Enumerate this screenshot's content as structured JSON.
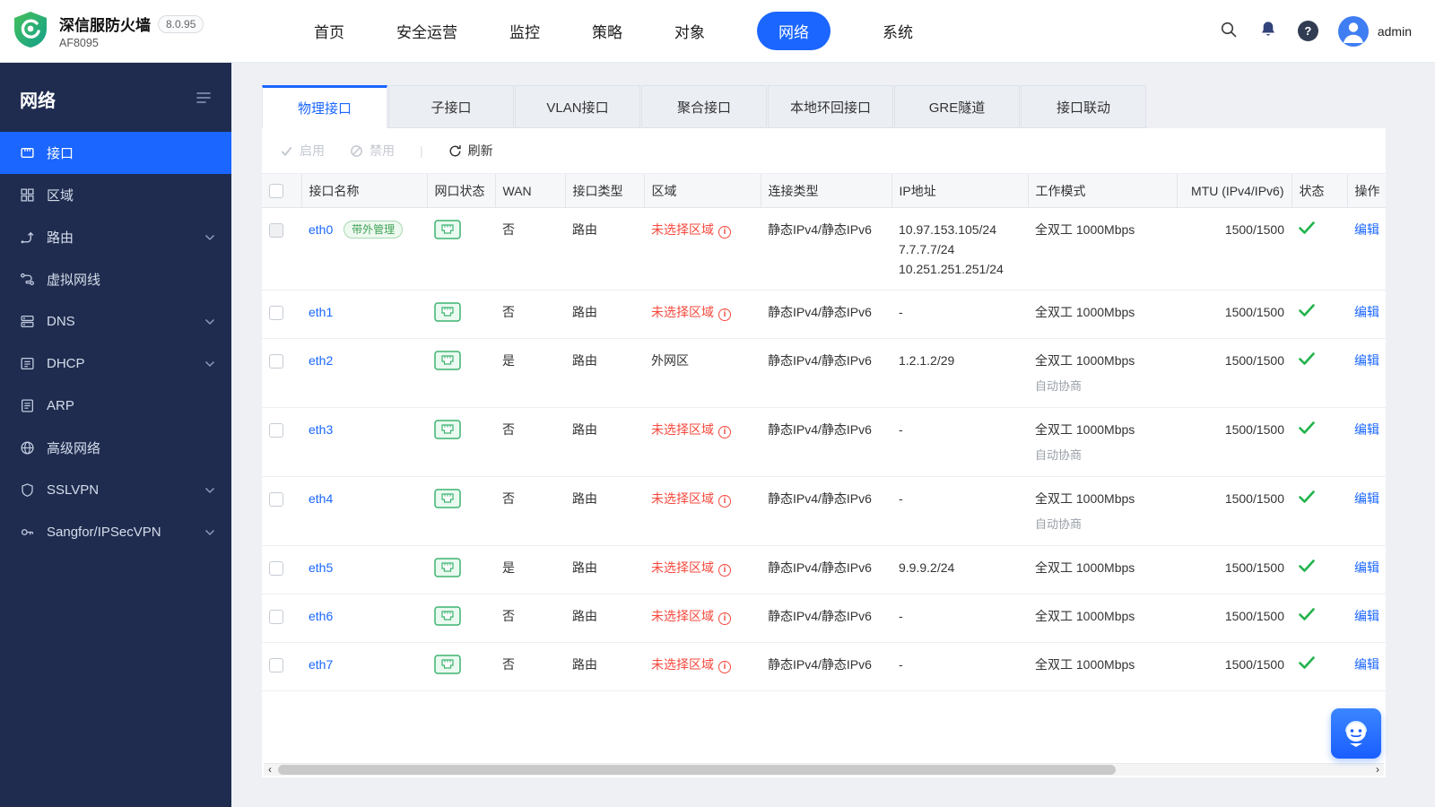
{
  "app": {
    "title": "深信服防火墙",
    "version": "8.0.95",
    "model": "AF8095",
    "user": "admin"
  },
  "colors": {
    "accent": "#1a66ff",
    "danger": "#f5493d",
    "success": "#21b24b",
    "sidebar_bg": "#1f2c4f"
  },
  "icons": {
    "status-ok": "check",
    "zone-alert": "i",
    "search": "magnifier",
    "notifications": "bell",
    "help": "?",
    "left-arrow": "‹",
    "right-arrow": "›"
  },
  "topnav": {
    "items": [
      {
        "label": "首页"
      },
      {
        "label": "安全运营"
      },
      {
        "label": "监控"
      },
      {
        "label": "策略"
      },
      {
        "label": "对象"
      },
      {
        "label": "网络",
        "active": true
      },
      {
        "label": "系统"
      }
    ]
  },
  "sidebar": {
    "title": "网络",
    "items": [
      {
        "label": "接口",
        "active": true
      },
      {
        "label": "区域"
      },
      {
        "label": "路由",
        "expandable": true
      },
      {
        "label": "虚拟网线"
      },
      {
        "label": "DNS",
        "expandable": true
      },
      {
        "label": "DHCP",
        "expandable": true
      },
      {
        "label": "ARP"
      },
      {
        "label": "高级网络"
      },
      {
        "label": "SSLVPN",
        "expandable": true
      },
      {
        "label": "Sangfor/IPSecVPN",
        "expandable": true
      }
    ]
  },
  "tabs": [
    "物理接口",
    "子接口",
    "VLAN接口",
    "聚合接口",
    "本地环回接口",
    "GRE隧道",
    "接口联动"
  ],
  "toolbar": {
    "enable": "启用",
    "disable": "禁用",
    "refresh": "刷新"
  },
  "table": {
    "headers": [
      "接口名称",
      "网口状态",
      "WAN",
      "接口类型",
      "区域",
      "连接类型",
      "IP地址",
      "工作模式",
      "MTU (IPv4/IPv6)",
      "状态",
      "操作"
    ],
    "edit_label": "编辑",
    "rows": [
      {
        "name": "eth0",
        "badge": "带外管理",
        "wan": "否",
        "type": "路由",
        "zone": "未选择区域",
        "zone_alert": true,
        "conn": "静态IPv4/静态IPv6",
        "ips": [
          "10.97.153.105/24",
          "7.7.7.7/24",
          "10.251.251.251/24"
        ],
        "mode": "全双工 1000Mbps",
        "mtu": "1500/1500",
        "status": "ok"
      },
      {
        "name": "eth1",
        "wan": "否",
        "type": "路由",
        "zone": "未选择区域",
        "zone_alert": true,
        "conn": "静态IPv4/静态IPv6",
        "ip": "-",
        "mode": "全双工 1000Mbps",
        "mtu": "1500/1500",
        "status": "ok"
      },
      {
        "name": "eth2",
        "wan": "是",
        "type": "路由",
        "zone": "外网区",
        "zone_alert": false,
        "conn": "静态IPv4/静态IPv6",
        "ip": "1.2.1.2/29",
        "mode": "全双工 1000Mbps",
        "submode": "自动协商",
        "mtu": "1500/1500",
        "status": "ok"
      },
      {
        "name": "eth3",
        "wan": "否",
        "type": "路由",
        "zone": "未选择区域",
        "zone_alert": true,
        "conn": "静态IPv4/静态IPv6",
        "ip": "-",
        "mode": "全双工 1000Mbps",
        "submode": "自动协商",
        "mtu": "1500/1500",
        "status": "ok"
      },
      {
        "name": "eth4",
        "wan": "否",
        "type": "路由",
        "zone": "未选择区域",
        "zone_alert": true,
        "conn": "静态IPv4/静态IPv6",
        "ip": "-",
        "mode": "全双工 1000Mbps",
        "submode": "自动协商",
        "mtu": "1500/1500",
        "status": "ok"
      },
      {
        "name": "eth5",
        "wan": "是",
        "type": "路由",
        "zone": "未选择区域",
        "zone_alert": true,
        "conn": "静态IPv4/静态IPv6",
        "ip": "9.9.9.2/24",
        "mode": "全双工 1000Mbps",
        "mtu": "1500/1500",
        "status": "ok"
      },
      {
        "name": "eth6",
        "wan": "否",
        "type": "路由",
        "zone": "未选择区域",
        "zone_alert": true,
        "conn": "静态IPv4/静态IPv6",
        "ip": "-",
        "mode": "全双工 1000Mbps",
        "mtu": "1500/1500",
        "status": "ok"
      },
      {
        "name": "eth7",
        "wan": "否",
        "type": "路由",
        "zone": "未选择区域",
        "zone_alert": true,
        "conn": "静态IPv4/静态IPv6",
        "ip": "-",
        "mode": "全双工 1000Mbps",
        "mtu": "1500/1500",
        "status": "ok"
      }
    ]
  }
}
